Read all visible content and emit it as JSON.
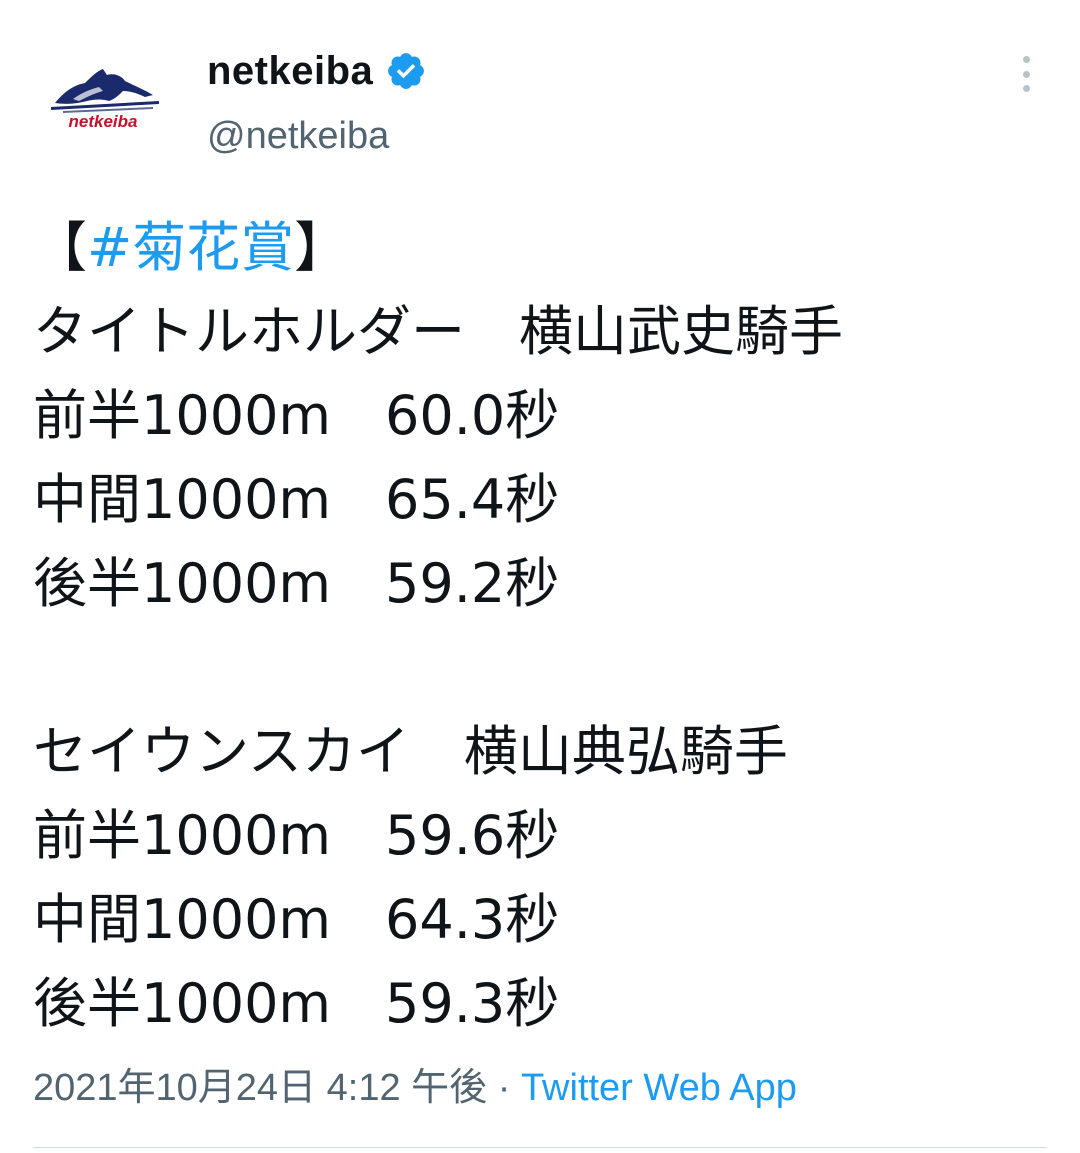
{
  "author": {
    "display_name": "netkeiba",
    "handle": "@netkeiba",
    "logo_text": "netkeiba",
    "verified": true
  },
  "tweet": {
    "hashtag_open": "【",
    "hashtag": "#菊花賞",
    "hashtag_close": "】",
    "horses": [
      {
        "title": "タイトルホルダー　横山武史騎手",
        "splits": [
          {
            "label": "前半1000m",
            "time": "60.0秒"
          },
          {
            "label": "中間1000m",
            "time": "65.4秒"
          },
          {
            "label": "後半1000m",
            "time": "59.2秒"
          }
        ]
      },
      {
        "title": "セイウンスカイ　横山典弘騎手",
        "splits": [
          {
            "label": "前半1000m",
            "time": "59.6秒"
          },
          {
            "label": "中間1000m",
            "time": "64.3秒"
          },
          {
            "label": "後半1000m",
            "time": "59.3秒"
          }
        ]
      }
    ]
  },
  "meta": {
    "timestamp": "2021年10月24日 4:12 午後",
    "separator": " · ",
    "source": "Twitter Web App"
  },
  "colors": {
    "link": "#1d9bf0",
    "secondary": "#536471",
    "text": "#0f1419",
    "logo_red": "#c8102e",
    "logo_navy": "#1a2a6c"
  }
}
